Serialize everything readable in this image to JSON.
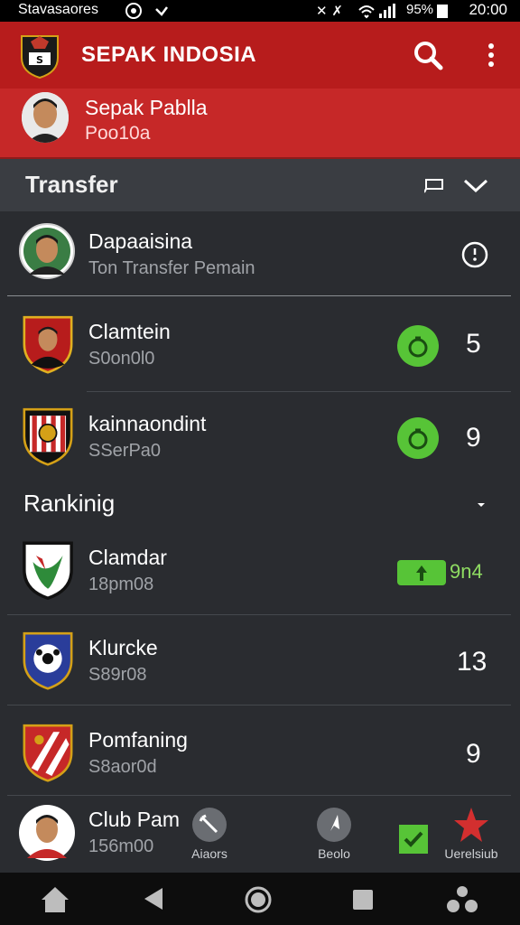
{
  "status_bar": {
    "left_text": "Stavasaores",
    "battery": "95%",
    "time": "20:00"
  },
  "app_bar": {
    "title": "SEPAK INDOSIA"
  },
  "profile": {
    "name": "Sepak Pablla",
    "subtitle": "Poo10a"
  },
  "transfer_section": {
    "title": "Transfer",
    "items": [
      {
        "title": "Dapaaisina",
        "subtitle": "Ton Transfer  Pemain",
        "value": ""
      },
      {
        "title": "Clamtein",
        "subtitle": "S0on0l0",
        "value": "5"
      },
      {
        "title": "kainnaondint",
        "subtitle": "SSerPa0",
        "value": "9"
      }
    ]
  },
  "ranking_section": {
    "title": "Rankinig",
    "items": [
      {
        "title": "Clamdar",
        "subtitle": "18pm08",
        "value": "9n4"
      },
      {
        "title": "Klurcke",
        "subtitle": "S89r08",
        "value": "13"
      },
      {
        "title": "Pomfaning",
        "subtitle": "S8aor0d",
        "value": "9"
      },
      {
        "title": "Club Pam",
        "subtitle": "156m00",
        "value": ""
      }
    ]
  },
  "bottom_tabs": [
    {
      "label": "Aiaors",
      "icon": "tool-icon"
    },
    {
      "label": "Beolo",
      "icon": "compass-icon"
    },
    {
      "label": "",
      "icon": "check-icon"
    },
    {
      "label": "Uerelsiub",
      "icon": "star-icon"
    }
  ],
  "colors": {
    "app_bar": "#b71c1c",
    "profile_bg": "#c62828",
    "background": "#2a2c30",
    "accent_green": "#57c437"
  }
}
